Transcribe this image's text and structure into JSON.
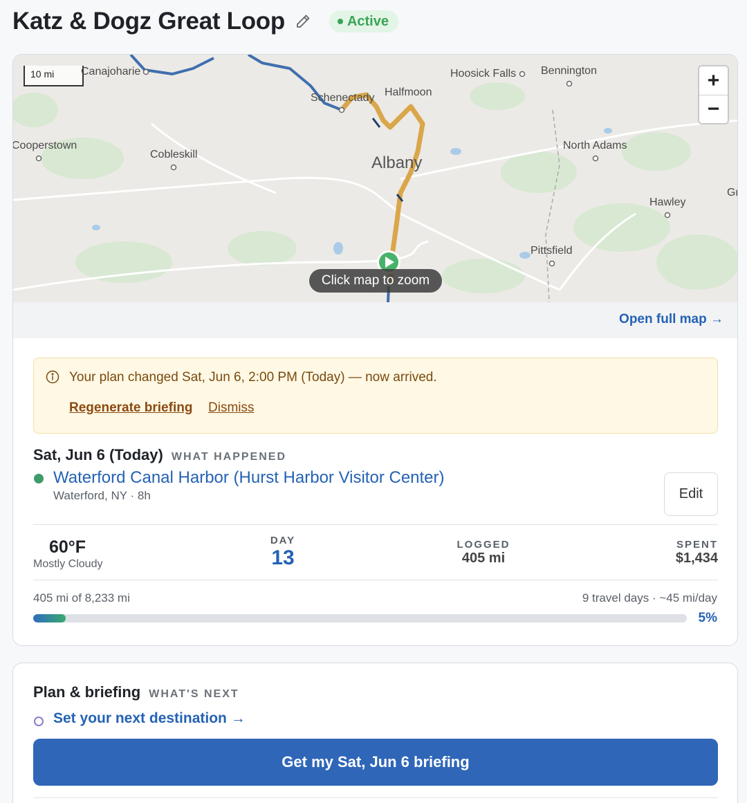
{
  "header": {
    "title": "Katz & Dogz Great Loop",
    "status": "Active",
    "edit_icon": "pencil-icon"
  },
  "map": {
    "scale_label": "10 mi",
    "places": {
      "canajoharie": "Canajoharie",
      "hoosick_falls": "Hoosick Falls",
      "bennington": "Bennington",
      "schenectady": "Schenectady",
      "halfmoon": "Halfmoon",
      "cooperstown": "Cooperstown",
      "cobleskill": "Cobleskill",
      "albany": "Albany",
      "north_adams": "North Adams",
      "hawley": "Hawley",
      "pittsfield": "Pittsfield",
      "edge_right": "Gr"
    },
    "zoom_in": "+",
    "zoom_out": "−",
    "click_hint": "Click map to zoom",
    "open_full": "Open full map →",
    "route_color": "#3f6fae",
    "active_leg_color": "#d9a64a"
  },
  "notice": {
    "message": "Your plan changed Sat, Jun 6, 2:00 PM (Today) — now arrived.",
    "regenerate": "Regenerate briefing",
    "dismiss": "Dismiss"
  },
  "today": {
    "date": "Sat, Jun 6 (Today)",
    "caption": "WHAT HAPPENED",
    "stop_name": "Waterford Canal Harbor (Hurst Harbor Visitor Center)",
    "stop_sub": "Waterford, NY · 8h",
    "edit": "Edit"
  },
  "stats": {
    "temp": "60°F",
    "condition": "Mostly Cloudy",
    "day_caption": "DAY",
    "day_value": "13",
    "logged_caption": "LOGGED",
    "logged_value": "405 mi",
    "spent_caption": "SPENT",
    "spent_value": "$1,434"
  },
  "progress": {
    "left": "405 mi of 8,233 mi",
    "right": "9 travel days · ~45 mi/day",
    "percent_label": "5%",
    "fraction": 0.05
  },
  "plan": {
    "title": "Plan & briefing",
    "caption": "WHAT'S NEXT",
    "next_link": "Set your next destination →",
    "cta": "Get my Sat, Jun 6 briefing"
  }
}
